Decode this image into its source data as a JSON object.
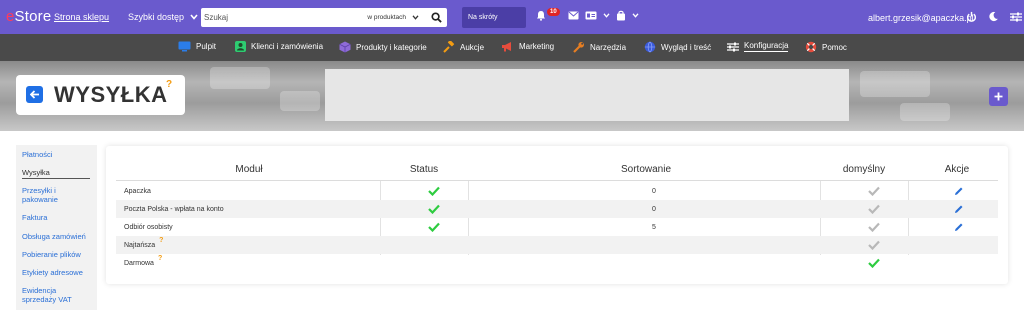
{
  "topbar": {
    "logo_prefix": "e",
    "logo_text": "Store",
    "store_link": "Strona sklepu",
    "quick_access": "Szybki dostęp",
    "search_value": "Szukaj",
    "search_scope": "w produktach",
    "shortcuts": "Na skróty",
    "notifications_count": "10",
    "user_email": "albert.grzesik@apaczka.pl",
    "accent_color": "#6a5acd"
  },
  "nav": {
    "items": [
      {
        "label": "Pulpit",
        "icon": "monitor-icon",
        "color": "#2b7de9"
      },
      {
        "label": "Klienci i zamówienia",
        "icon": "user-icon",
        "color": "#2ecc71"
      },
      {
        "label": "Produkty i kategorie",
        "icon": "cube-icon",
        "color": "#8e6bd8"
      },
      {
        "label": "Aukcje",
        "icon": "gavel-icon",
        "color": "#f39c12"
      },
      {
        "label": "Marketing",
        "icon": "megaphone-icon",
        "color": "#e74c3c"
      },
      {
        "label": "Narzędzia",
        "icon": "wrench-icon",
        "color": "#e67e22"
      },
      {
        "label": "Wygląd i treść",
        "icon": "globe-icon",
        "color": "#3b5bdb"
      },
      {
        "label": "Konfiguracja",
        "icon": "sliders-icon",
        "color": "#ffffff"
      },
      {
        "label": "Pomoc",
        "icon": "lifebuoy-icon",
        "color": "#e74c3c"
      }
    ]
  },
  "page": {
    "title": "WYSYŁKA",
    "help": "?"
  },
  "sidebar": {
    "items": [
      {
        "label": "Płatności"
      },
      {
        "label": "Wysyłka"
      },
      {
        "label": "Przesyłki i pakowanie"
      },
      {
        "label": "Faktura"
      },
      {
        "label": "Obsługa zamówień"
      },
      {
        "label": "Pobieranie plików"
      },
      {
        "label": "Etykiety adresowe"
      },
      {
        "label": "Ewidencja sprzedaży VAT"
      }
    ]
  },
  "table": {
    "headers": {
      "module": "Moduł",
      "status": "Status",
      "sort": "Sortowanie",
      "default": "domyślny",
      "actions": "Akcje"
    },
    "rows": [
      {
        "module": "Apaczka",
        "status": "active",
        "sort": "0",
        "default": "inactive",
        "edit": true,
        "help": false
      },
      {
        "module": "Poczta Polska - wpłata na konto",
        "status": "active",
        "sort": "0",
        "default": "inactive",
        "edit": true,
        "help": false
      },
      {
        "module": "Odbiór osobisty",
        "status": "active",
        "sort": "5",
        "default": "inactive",
        "edit": true,
        "help": false
      },
      {
        "module": "Najtańsza",
        "status": "",
        "sort": "",
        "default": "inactive",
        "edit": false,
        "help": true
      },
      {
        "module": "Darmowa",
        "status": "",
        "sort": "",
        "default": "active",
        "edit": false,
        "help": true
      }
    ],
    "check_active_color": "#2ecc40",
    "check_inactive_color": "#b8b8b8",
    "help_mark": "?"
  }
}
